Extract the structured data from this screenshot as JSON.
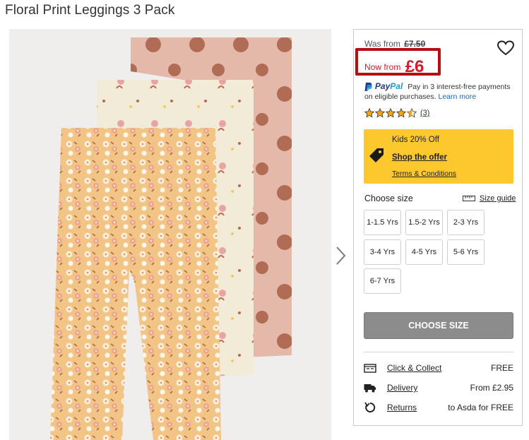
{
  "product": {
    "title": "Floral Print Leggings 3 Pack"
  },
  "pricing": {
    "was_label": "Was from",
    "was_price": "£7.50",
    "now_label": "Now from",
    "now_price": "£6"
  },
  "paypal": {
    "brand_pay": "Pay",
    "brand_pal": "Pal",
    "message": "Pay in 3 interest-free payments on eligible purchases.",
    "learn_more": "Learn more"
  },
  "rating": {
    "stars": 4.5,
    "count": "(3)"
  },
  "promo": {
    "title": "Kids 20% Off",
    "link": "Shop the offer",
    "terms": "Terms & Conditions",
    "background": "#fdc72e"
  },
  "sizes": {
    "title": "Choose size",
    "guide": "Size guide",
    "options": [
      "1-1.5 Yrs",
      "1.5-2 Yrs",
      "2-3 Yrs",
      "3-4 Yrs",
      "4-5 Yrs",
      "5-6 Yrs",
      "6-7 Yrs"
    ]
  },
  "cta": {
    "label": "CHOOSE SIZE"
  },
  "delivery": [
    {
      "icon": "store-icon",
      "label": "Click & Collect",
      "value": "FREE"
    },
    {
      "icon": "truck-icon",
      "label": "Delivery",
      "value": "From £2.95"
    },
    {
      "icon": "returns-icon",
      "label": "Returns",
      "value": "to Asda for FREE"
    }
  ],
  "colors": {
    "price_red": "#d01c2c",
    "highlight_border": "#b40f13",
    "cta_grey": "#8c8c8c",
    "paypal_blue": "#1e3a8a"
  }
}
